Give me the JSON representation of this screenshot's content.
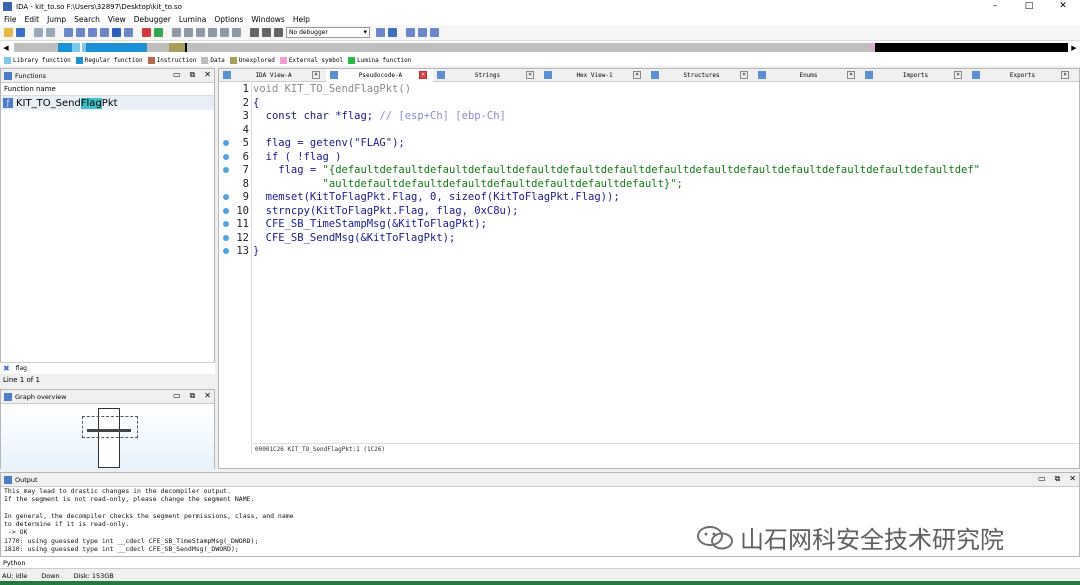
{
  "title": "IDA - kit_to.so F:\\Users\\32897\\Desktop\\kit_to.so",
  "window_controls": [
    "–",
    "□",
    "✕"
  ],
  "menu": [
    "File",
    "Edit",
    "Jump",
    "Search",
    "View",
    "Debugger",
    "Lumina",
    "Options",
    "Windows",
    "Help"
  ],
  "toolbar": {
    "debugger_select": "No debugger"
  },
  "legend": [
    {
      "label": "Library function",
      "color": "#7ec8ee"
    },
    {
      "label": "Regular function",
      "color": "#1e90d8"
    },
    {
      "label": "Instruction",
      "color": "#b5694a"
    },
    {
      "label": "Data",
      "color": "#bdbdbd"
    },
    {
      "label": "Unexplored",
      "color": "#a8a058"
    },
    {
      "label": "External symbol",
      "color": "#f49bd8"
    },
    {
      "label": "Lumina function",
      "color": "#2dbb3f"
    }
  ],
  "functions_panel": {
    "title": "Functions",
    "column": "Function name",
    "items": [
      {
        "pre": "KIT_TO_Send",
        "hl": "Flag",
        "post": "Pkt"
      }
    ],
    "search": "flag",
    "line_of": "Line 1 of 1"
  },
  "graph_panel": {
    "title": "Graph overview"
  },
  "tabs": [
    {
      "label": "IDA View-A",
      "active": false
    },
    {
      "label": "Pseudocode-A",
      "active": true
    },
    {
      "label": "Strings",
      "active": false
    },
    {
      "label": "Hex View-1",
      "active": false
    },
    {
      "label": "Structures",
      "active": false
    },
    {
      "label": "Enums",
      "active": false
    },
    {
      "label": "Imports",
      "active": false
    },
    {
      "label": "Exports",
      "active": false
    }
  ],
  "code": {
    "line1": "void KIT_TO_SendFlagPkt()",
    "line2": "{",
    "line3a": "  const char *flag; ",
    "line3b": "// [esp+Ch] [ebp-Ch]",
    "line4": "",
    "line5": "  flag = getenv(\"FLAG\");",
    "line6": "  if ( !flag )",
    "line7a": "    flag = ",
    "line7b": "\"{defaultdefaultdefaultdefaultdefaultdefaultdefaultdefaultdefaultdefaultdefaultdefaultdefaultdefaultdef\"",
    "line8": "           \"aultdefaultdefaultdefaultdefaultdefaultdefaultdefault}\";",
    "line9": "  memset(KitToFlagPkt.Flag, 0, sizeof(KitToFlagPkt.Flag));",
    "line10": "  strncpy(KitToFlagPkt.Flag, flag, 0xC8u);",
    "line11": "  CFE_SB_TimeStampMsg(&KitToFlagPkt);",
    "line12": "  CFE_SB_SendMsg(&KitToFlagPkt);",
    "line13": "}",
    "status": "00001C26 KIT_TO_SendFlagPkt:1 (1C26)"
  },
  "output": {
    "title": "Output",
    "lines": "This may lead to drastic changes in the decompiler output.\nIf the segment is not read-only, please change the segment NAME.\n\nIn general, the decompiler checks the segment permissions, class, and name\nto determine if it is read-only.\n -> OK\n1770: using guessed type int __cdecl CFE_SB_TimeStampMsg(_DWORD);\n1810: using guessed type int __cdecl CFE_SB_SendMsg(_DWORD);"
  },
  "python_label": "Python",
  "statusbar": {
    "au": "AU:  idle",
    "dir": "Down",
    "disk": "Disk: 153GB"
  },
  "watermark": "山石网科安全技术研究院"
}
